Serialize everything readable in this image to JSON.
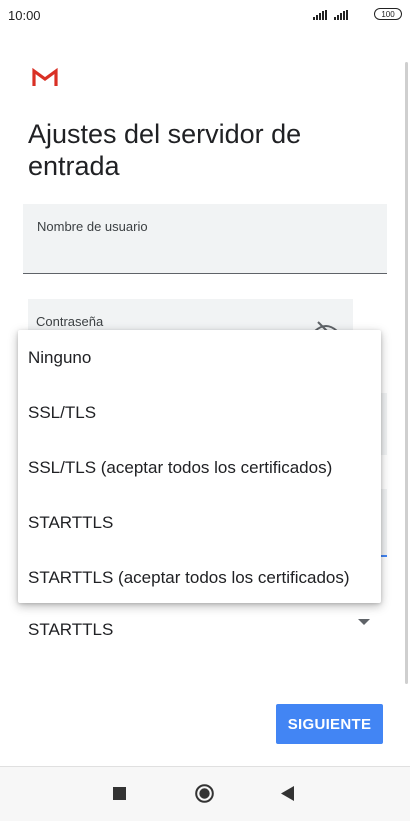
{
  "status_bar": {
    "time": "10:00",
    "battery": "100"
  },
  "page": {
    "title": "Ajustes del servidor de entrada"
  },
  "form": {
    "username_label": "Nombre de usuario",
    "password_label": "Contraseña",
    "security_type_value": "STARTTLS"
  },
  "menu": {
    "items": [
      {
        "label": "Ninguno"
      },
      {
        "label": "SSL/TLS"
      },
      {
        "label": "SSL/TLS (aceptar todos los certificados)"
      },
      {
        "label": "STARTTLS"
      },
      {
        "label": "STARTTLS (aceptar todos los certificados)"
      }
    ]
  },
  "actions": {
    "next_label": "SIGUIENTE"
  },
  "colors": {
    "accent": "#4285f4",
    "gmail_red": "#d93025"
  }
}
